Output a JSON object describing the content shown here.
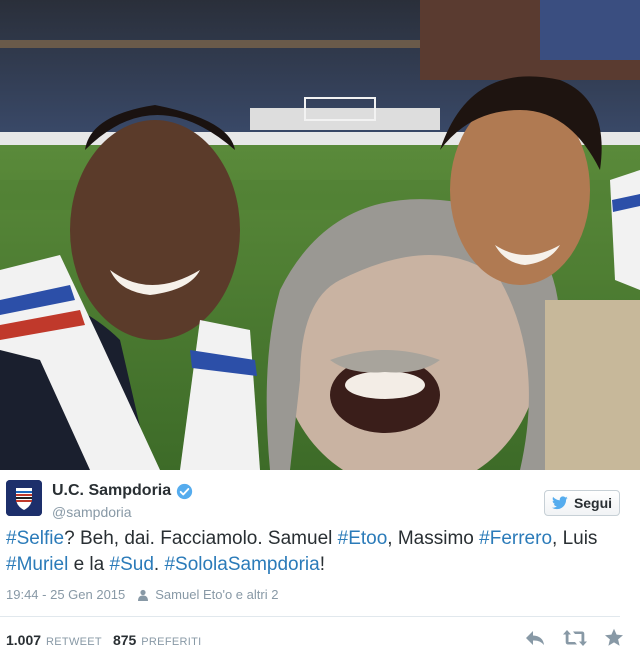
{
  "tweet": {
    "display_name": "U.C. Sampdoria",
    "handle": "@sampdoria",
    "follow_label": "Segui",
    "text_parts": [
      {
        "t": "#Selfie",
        "tag": true
      },
      {
        "t": "? Beh, dai. Facciamolo. Samuel ",
        "tag": false
      },
      {
        "t": "#Etoo",
        "tag": true
      },
      {
        "t": ", Massimo ",
        "tag": false
      },
      {
        "t": "#Ferrero",
        "tag": true
      },
      {
        "t": ", Luis ",
        "tag": false
      },
      {
        "t": "#Muriel",
        "tag": true
      },
      {
        "t": " e la ",
        "tag": false
      },
      {
        "t": "#Sud",
        "tag": true
      },
      {
        "t": ". ",
        "tag": false
      },
      {
        "t": "#SololaSampdoria",
        "tag": true
      },
      {
        "t": "!",
        "tag": false
      }
    ],
    "timestamp": "19:44 - 25 Gen 2015",
    "tagged_people": "Samuel Eto'o e altri 2",
    "retweets_count": "1.007",
    "retweets_label": "RETWEET",
    "favorites_count": "875",
    "favorites_label": "PREFERITI"
  },
  "icons": {
    "verified": "verified-badge-icon",
    "bird": "twitter-bird-icon",
    "person": "person-tag-icon",
    "reply": "reply-icon",
    "retweet": "retweet-icon",
    "favorite": "star-icon"
  },
  "colors": {
    "hashtag": "#2b7bb9",
    "verified": "#55acee",
    "bird": "#55acee",
    "muted": "#8899a6",
    "text": "#292f33",
    "sampdoria_blue": "#1d2f6b"
  }
}
